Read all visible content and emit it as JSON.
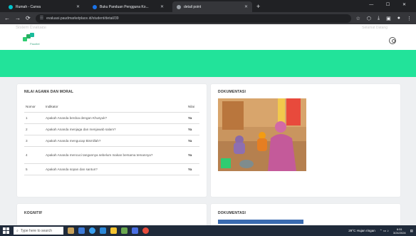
{
  "browser": {
    "tabs": [
      {
        "title": "Rumah - Canva",
        "favicon_color": "#00c4cc"
      },
      {
        "title": "Buku Panduan Pengguna Ko...",
        "favicon_color": "#1a73e8"
      },
      {
        "title": "detail point",
        "favicon_color": "#e8eaed"
      }
    ],
    "new_tab": "+",
    "url": "evaluasi.paudmarketplace.id/student/detail/39",
    "window_controls": "— ☐ ✕"
  },
  "app": {
    "logo_subtitle": "Paudtel",
    "faded_left": "Sistem Evaluasi",
    "faded_right": "Selamat Datang"
  },
  "card_nilai": {
    "title": "NILAI AGAMA DAN MORAL",
    "headers": {
      "no": "Nomor",
      "indikator": "Indikator",
      "nilai": "Nilai"
    },
    "rows": [
      {
        "no": "1",
        "indikator": "Apakah Ananda berdoa dengan Khusyuk?",
        "nilai": "Ya"
      },
      {
        "no": "2",
        "indikator": "Apakah Ananda menjaga dan menjawab salam?",
        "nilai": "Ya"
      },
      {
        "no": "3",
        "indikator": "Apakah Ananda mengucap Bismillah?",
        "nilai": "Ya"
      },
      {
        "no": "4",
        "indikator": "Apakah Ananda mencuci tangannya sebelum makan bersama temannya?",
        "nilai": "Ya"
      },
      {
        "no": "5",
        "indikator": "Apakah Ananda sopan dan santun?",
        "nilai": "Ya"
      }
    ]
  },
  "card_dok1": {
    "title": "DOKUMENTASI"
  },
  "card_kognitif": {
    "title": "KOGNITIF"
  },
  "card_dok2": {
    "title": "DOKUMENTASI"
  },
  "taskbar": {
    "search_placeholder": "Type here to search",
    "weather": "29°C Hujan ringan",
    "time": "8:51",
    "date": "3/24/2024"
  },
  "colors": {
    "accent_green": "#22e39a",
    "browser_dark": "#202124"
  }
}
